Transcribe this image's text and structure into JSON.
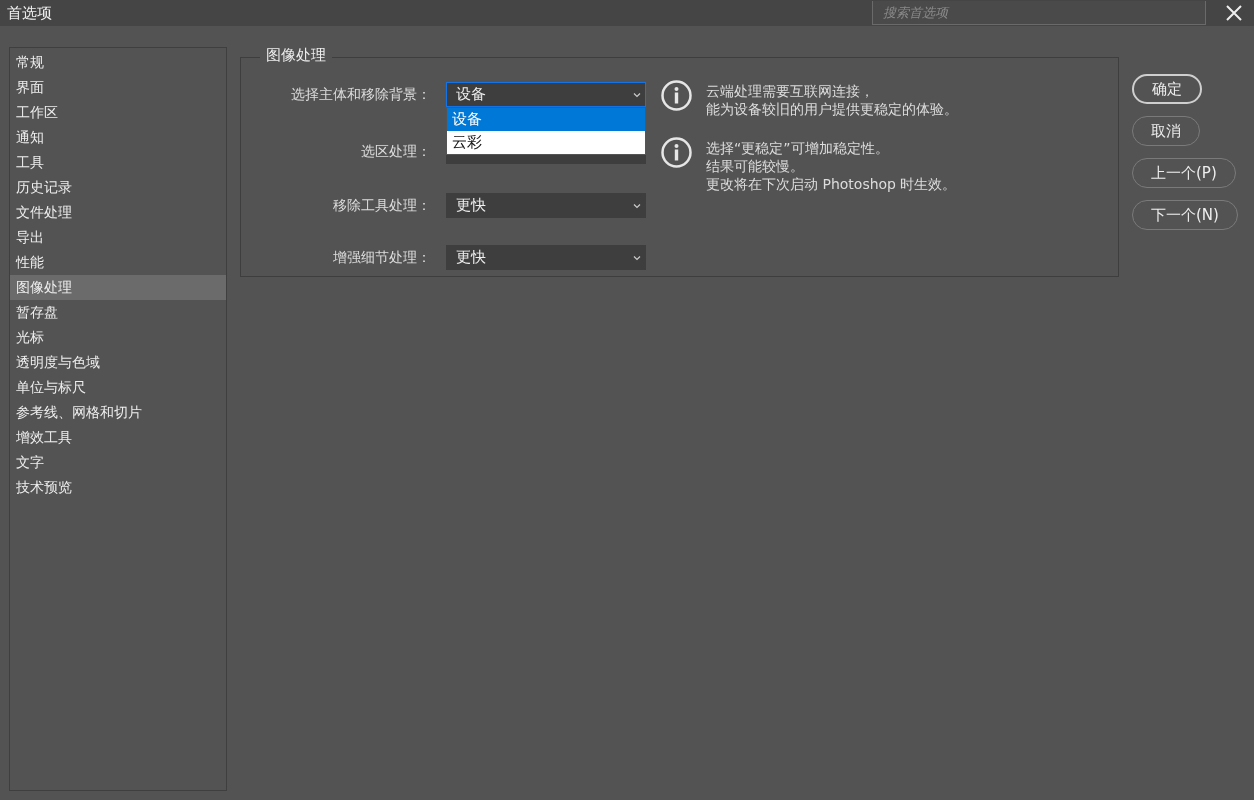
{
  "window": {
    "title": "首选项",
    "search_placeholder": "搜索首选项"
  },
  "sidebar": {
    "items": [
      {
        "label": "常规",
        "selected": false
      },
      {
        "label": "界面",
        "selected": false
      },
      {
        "label": "工作区",
        "selected": false
      },
      {
        "label": "通知",
        "selected": false
      },
      {
        "label": "工具",
        "selected": false
      },
      {
        "label": "历史记录",
        "selected": false
      },
      {
        "label": "文件处理",
        "selected": false
      },
      {
        "label": "导出",
        "selected": false
      },
      {
        "label": "性能",
        "selected": false
      },
      {
        "label": "图像处理",
        "selected": true
      },
      {
        "label": "暂存盘",
        "selected": false
      },
      {
        "label": "光标",
        "selected": false
      },
      {
        "label": "透明度与色域",
        "selected": false
      },
      {
        "label": "单位与标尺",
        "selected": false
      },
      {
        "label": "参考线、网格和切片",
        "selected": false
      },
      {
        "label": "增效工具",
        "selected": false
      },
      {
        "label": "文字",
        "selected": false
      },
      {
        "label": "技术预览",
        "selected": false
      }
    ]
  },
  "section": {
    "title": "图像处理",
    "settings": [
      {
        "label": "选择主体和移除背景：",
        "value": "设备",
        "expanded": true,
        "options": [
          {
            "label": "设备",
            "selected": true
          },
          {
            "label": "云彩",
            "selected": false
          }
        ],
        "info": [
          "云端处理需要互联网连接，",
          "能为设备较旧的用户提供更稳定的体验。"
        ]
      },
      {
        "label": "选区处理：",
        "expanded": false,
        "info": [
          "选择“更稳定”可增加稳定性。",
          "结果可能较慢。",
          "更改将在下次启动 Photoshop 时生效。"
        ]
      },
      {
        "label": "移除工具处理：",
        "value": "更快",
        "expanded": false
      },
      {
        "label": "增强细节处理：",
        "value": "更快",
        "expanded": false
      }
    ]
  },
  "buttons": [
    {
      "label": "确定",
      "primary": true
    },
    {
      "label": "取消",
      "primary": false
    },
    {
      "label": "上一个(P)",
      "primary": false
    },
    {
      "label": "下一个(N)",
      "primary": false
    }
  ]
}
